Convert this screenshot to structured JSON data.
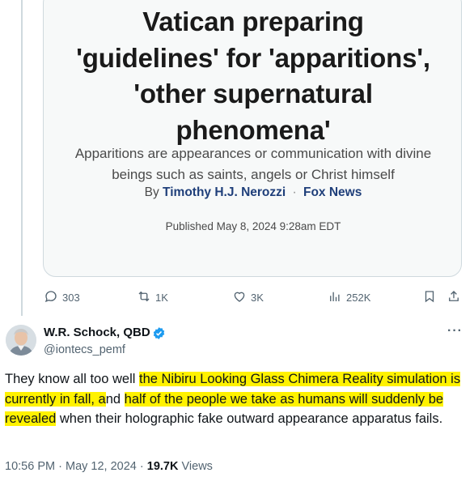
{
  "article": {
    "headline_lines": [
      "Vatican preparing",
      "'guidelines' for 'apparitions',",
      "'other supernatural",
      "phenomena'"
    ],
    "dek_lines": [
      "Apparitions are appearances or communication with divine",
      "beings such as saints, angels or Christ himself"
    ],
    "byline_prefix": "By",
    "author": "Timothy H.J. Nerozzi",
    "separator": "·",
    "outlet": "Fox News",
    "published": "Published May 8, 2024 9:28am EDT"
  },
  "actions": {
    "replies": "303",
    "retweets": "1K",
    "likes": "3K",
    "views": "252K"
  },
  "tweet": {
    "display_name": "W.R. Schock, QBD",
    "handle": "@iontecs_pemf",
    "body_parts": [
      {
        "text": "They know all too well ",
        "highlight": false
      },
      {
        "text": "the Nibiru Looking Glass Chimera Reality simulation is currently in fall, a",
        "highlight": true
      },
      {
        "text": "nd ",
        "highlight": false
      },
      {
        "text": "half of the people we take as humans will suddenly be revealed",
        "highlight": true
      },
      {
        "text": " when their holographic fake outward appearance apparatus fails.",
        "highlight": false
      }
    ],
    "time": "10:56 PM",
    "date": "May 12, 2024",
    "views_count": "19.7K",
    "views_label": "Views",
    "dot": "·"
  },
  "colors": {
    "highlight": "#fff200",
    "secondary_text": "#536471",
    "verified": "#1d9bf0",
    "outlet_link": "#1f3f7a"
  },
  "icons": [
    "reply-icon",
    "retweet-icon",
    "like-icon",
    "views-icon",
    "bookmark-icon",
    "share-icon",
    "verified-badge-icon",
    "more-icon"
  ]
}
